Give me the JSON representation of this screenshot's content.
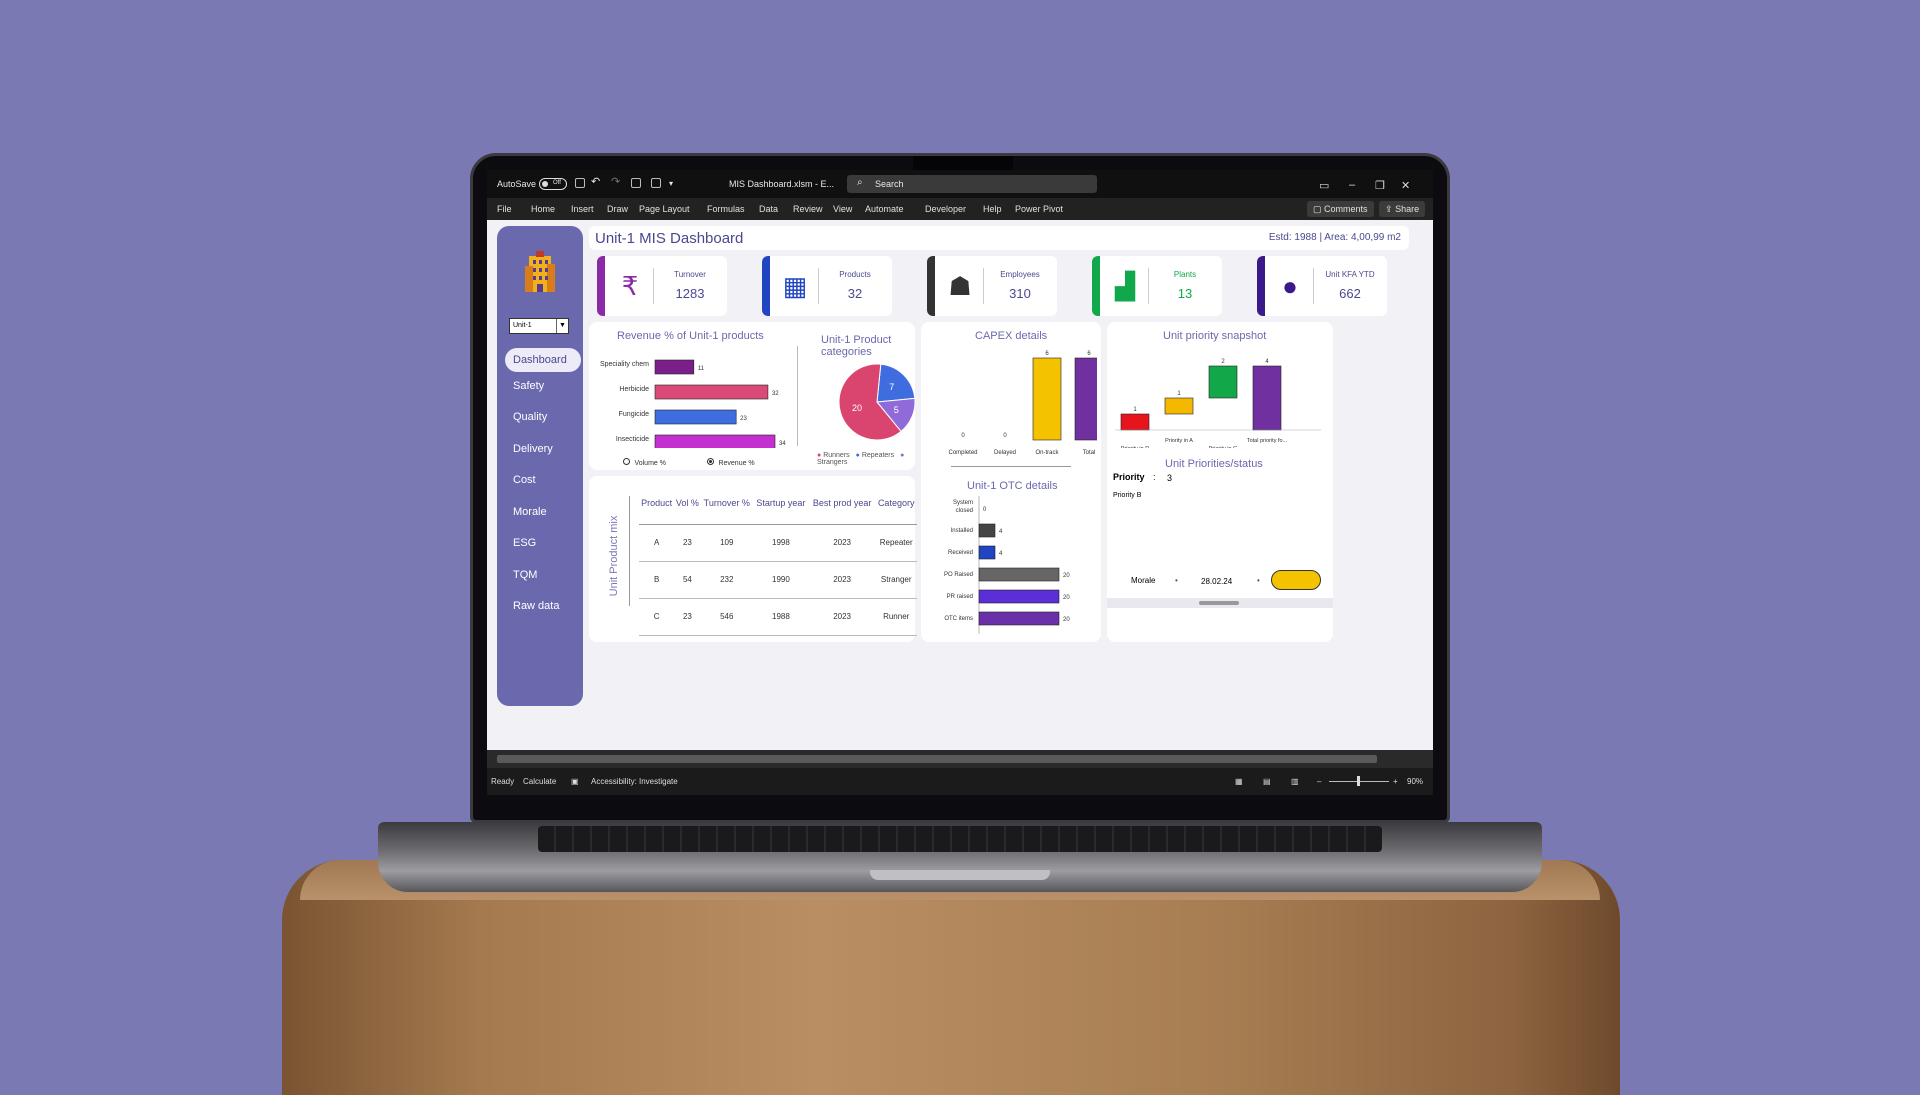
{
  "excel": {
    "autosave_label": "AutoSave",
    "autosave_state": "Off",
    "file_name": "MIS Dashboard.xlsm  -  E...",
    "search_placeholder": "Search",
    "ribbon_tabs": [
      "File",
      "Home",
      "Insert",
      "Draw",
      "Page Layout",
      "Formulas",
      "Data",
      "Review",
      "View",
      "Automate",
      "Developer",
      "Help",
      "Power Pivot"
    ],
    "comments_label": "Comments",
    "share_label": "Share",
    "status": {
      "ready": "Ready",
      "calculate": "Calculate",
      "accessibility": "Accessibility: Investigate",
      "zoom": "90%"
    }
  },
  "sidebar": {
    "unit_select": "Unit-1",
    "items": [
      "Dashboard",
      "Safety",
      "Quality",
      "Delivery",
      "Cost",
      "Morale",
      "ESG",
      "TQM",
      "Raw data"
    ],
    "active": "Dashboard"
  },
  "header": {
    "title": "Unit-1 MIS Dashboard",
    "info": "Estd: 1988 | Area: 4,00,99 m2"
  },
  "kpis": [
    {
      "label": "Turnover",
      "value": "1283",
      "color": "#8a2aa8",
      "icon": "rupee-icon"
    },
    {
      "label": "Products",
      "value": "32",
      "color": "#1f45c2",
      "icon": "boxes-icon"
    },
    {
      "label": "Employees",
      "value": "310",
      "color": "#333333",
      "icon": "people-icon"
    },
    {
      "label": "Plants",
      "value": "13",
      "color": "#10a84a",
      "icon": "factory-icon"
    },
    {
      "label": "Unit KFA YTD",
      "value": "662",
      "color": "#3a1a8a",
      "icon": "piggy-bank-icon"
    }
  ],
  "revenue_chart": {
    "title": "Revenue % of Unit-1 products",
    "radio_volume": "Volume %",
    "radio_revenue": "Revenue %"
  },
  "category_chart": {
    "title": "Unit-1 Product categories",
    "legend": [
      "Runners",
      "Repeaters",
      "Strangers"
    ]
  },
  "capex": {
    "title": "CAPEX details"
  },
  "otc": {
    "title": "Unit-1 OTC details"
  },
  "priority": {
    "title": "Unit priority snapshot"
  },
  "priority_status": {
    "title": "Unit Priorities/status",
    "priority_label": "Priority",
    "colon": ":",
    "priority_value": "3",
    "priority_b": "Priority B",
    "morale_label": "Morale",
    "morale_date": "28.02.24"
  },
  "product_mix": {
    "side_label": "Unit Product mix",
    "headers": [
      "Product",
      "Vol %",
      "Turnover %",
      "Startup year",
      "Best prod year",
      "Category"
    ],
    "rows": [
      [
        "A",
        "23",
        "109",
        "1998",
        "2023",
        "Repeater"
      ],
      [
        "B",
        "54",
        "232",
        "1990",
        "2023",
        "Stranger"
      ],
      [
        "C",
        "23",
        "546",
        "1988",
        "2023",
        "Runner"
      ]
    ]
  },
  "chart_data": [
    {
      "type": "bar",
      "title": "Revenue % of Unit-1 products",
      "orientation": "horizontal",
      "categories": [
        "Speciality chem",
        "Herbicide",
        "Fungicide",
        "Insecticide"
      ],
      "values": [
        11,
        32,
        23,
        34
      ],
      "colors": [
        "#7a1f8a",
        "#d94a78",
        "#3f6de0",
        "#c42fcf"
      ]
    },
    {
      "type": "pie",
      "title": "Unit-1 Product categories",
      "labels": [
        "Runners",
        "Repeaters",
        "Strangers"
      ],
      "values": [
        20,
        7,
        5
      ],
      "colors": [
        "#d9456e",
        "#3f6de0",
        "#8f6ad8"
      ]
    },
    {
      "type": "bar",
      "title": "CAPEX details",
      "categories": [
        "Completed",
        "Delayed",
        "On-track",
        "Total"
      ],
      "values": [
        0,
        0,
        6,
        6
      ],
      "colors": [
        "#f5c200",
        "#f5c200",
        "#f5c200",
        "#7030a0"
      ]
    },
    {
      "type": "bar",
      "title": "Unit-1 OTC details",
      "orientation": "horizontal",
      "categories": [
        "System closed",
        "Installed",
        "Received",
        "PO Raised",
        "PR raised",
        "OTC items"
      ],
      "values": [
        0,
        4,
        4,
        20,
        20,
        20
      ],
      "colors": [
        "#555555",
        "#444444",
        "#1f45c2",
        "#666666",
        "#5a2fd8",
        "#6a30a8"
      ]
    },
    {
      "type": "bar",
      "title": "Unit priority snapshot",
      "subtype": "waterfall",
      "categories": [
        "Priority in R",
        "Priority in A",
        "Priority in G",
        "Total priority fo..."
      ],
      "values": [
        1,
        1,
        2,
        4
      ],
      "colors": [
        "#e8141c",
        "#f5b800",
        "#12a84a",
        "#7030a0"
      ]
    }
  ]
}
